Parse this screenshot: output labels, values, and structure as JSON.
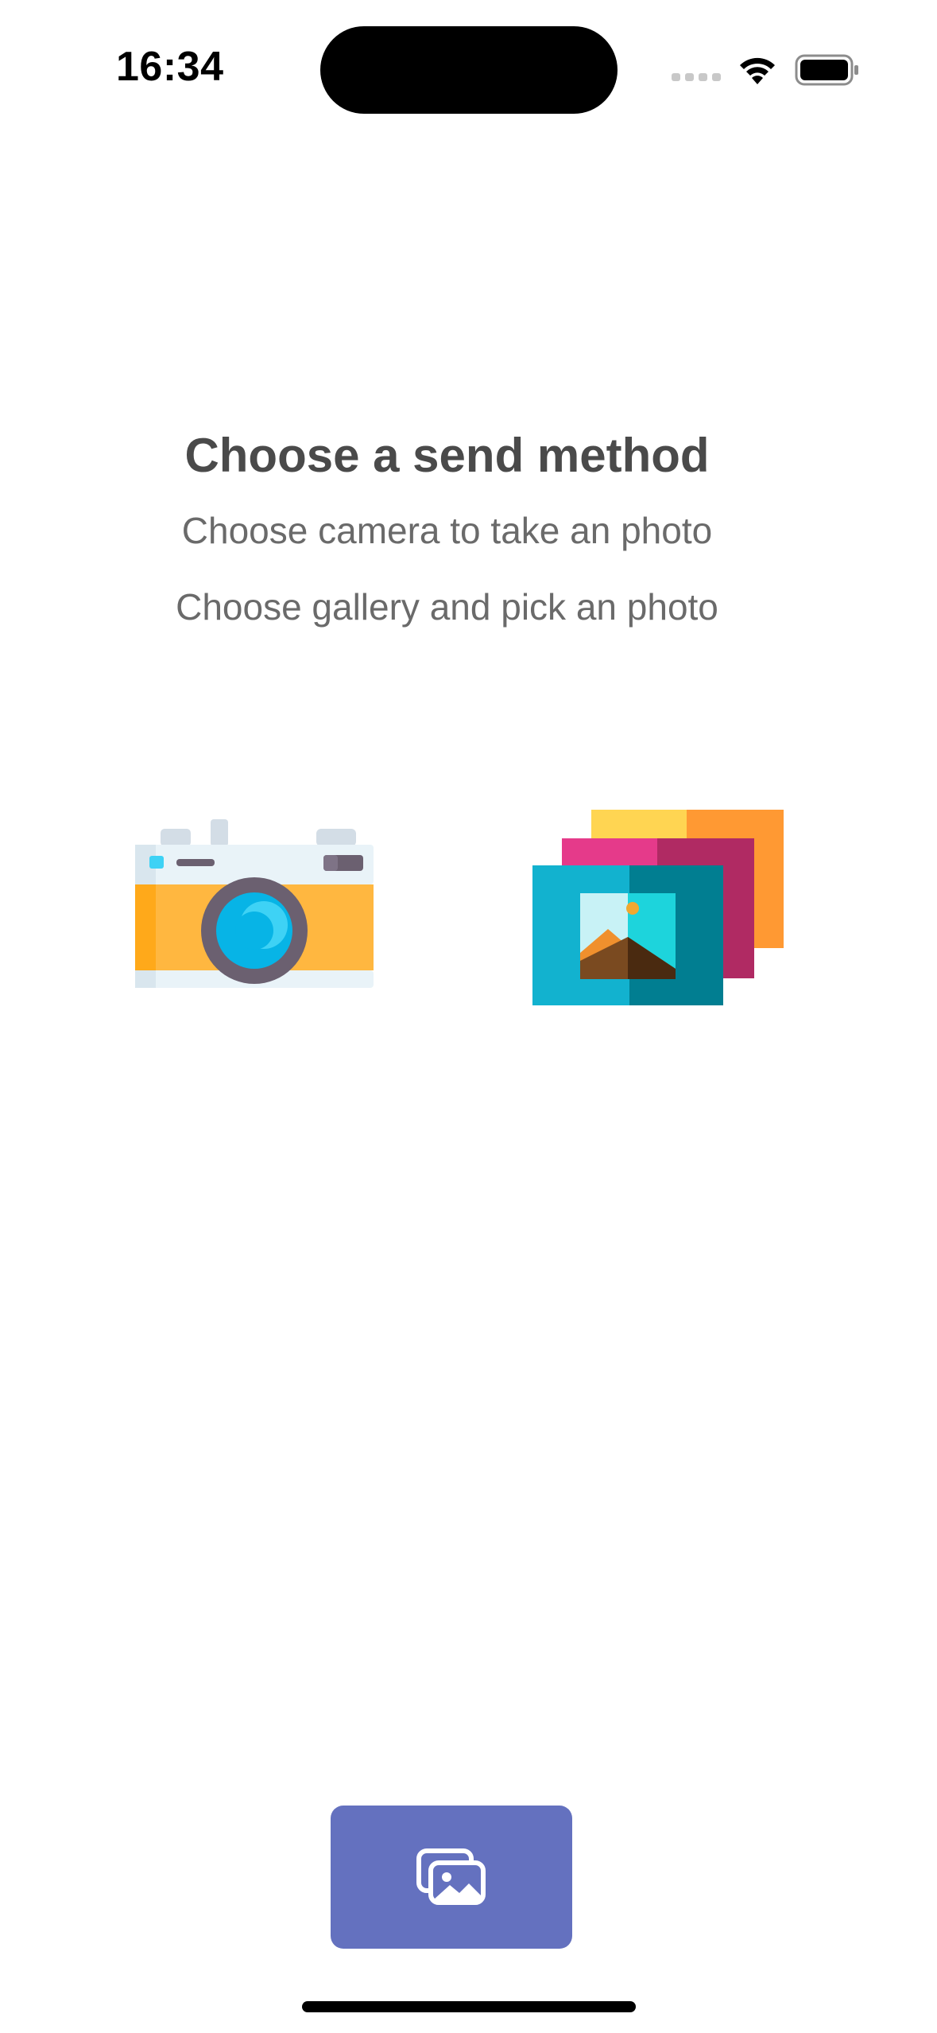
{
  "status_bar": {
    "time": "16:34"
  },
  "content": {
    "title": "Choose a send method",
    "camera_hint": "Choose camera to take an photo",
    "gallery_hint": "Choose gallery and pick an photo"
  },
  "options": {
    "camera_icon": "camera-icon",
    "gallery_icon": "photo-gallery-icon"
  },
  "bottom_button": {
    "icon": "images-icon",
    "color": "#6471bf"
  }
}
